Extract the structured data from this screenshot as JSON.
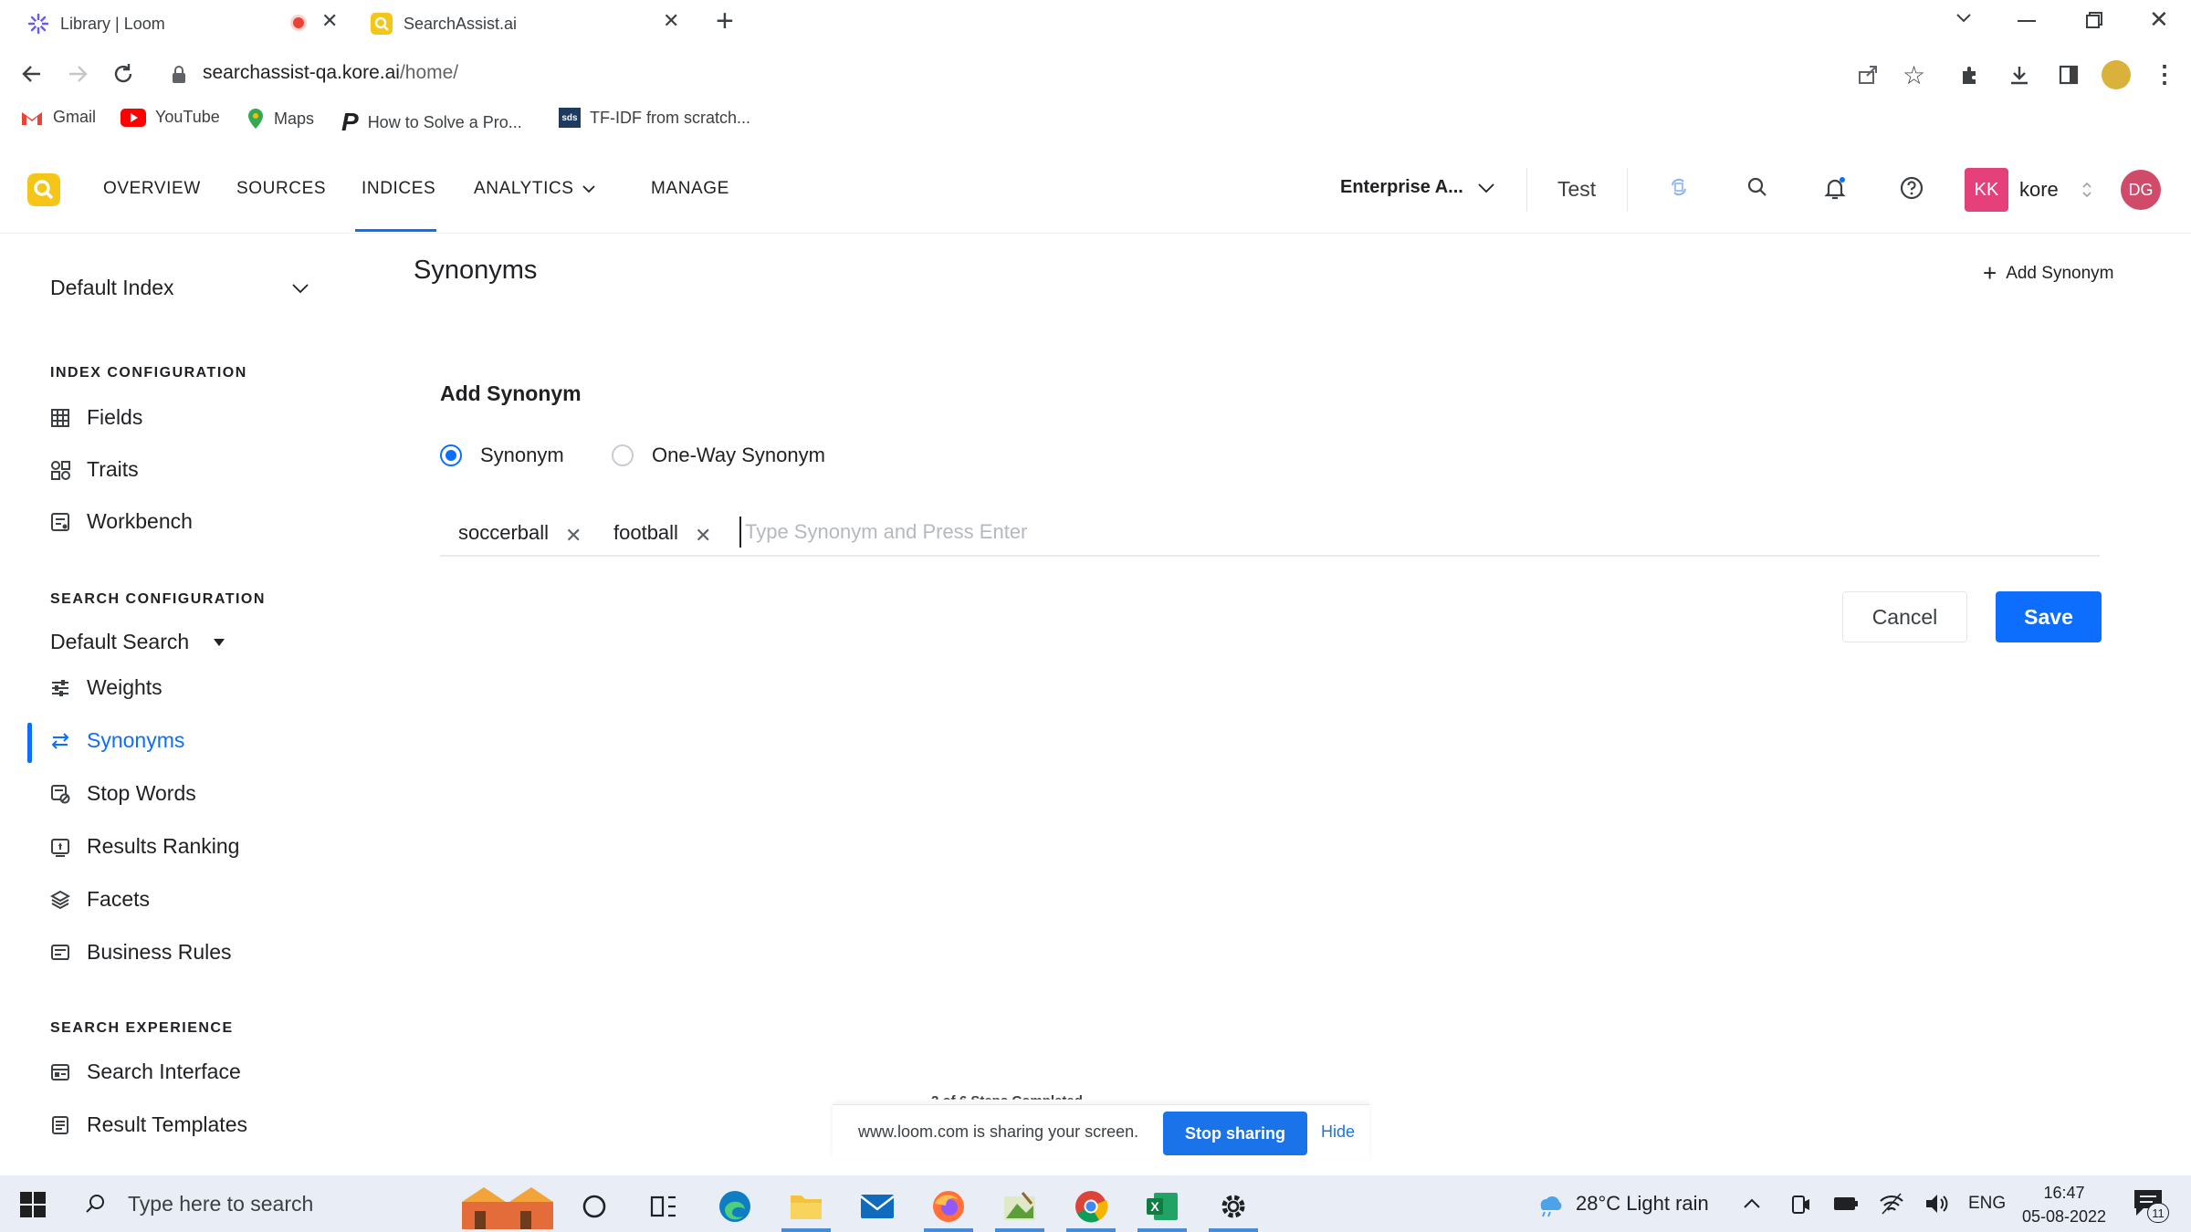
{
  "browser": {
    "tabs": [
      {
        "title": "Library | Loom",
        "icon": "loom-icon",
        "recording": true
      },
      {
        "title": "SearchAssist.ai",
        "icon": "searchassist-icon",
        "active": true
      }
    ],
    "url_host": "searchassist-qa.kore.ai",
    "url_path": "/home/",
    "bookmarks": [
      {
        "label": "Gmail",
        "icon": "gmail-icon"
      },
      {
        "label": "YouTube",
        "icon": "youtube-icon"
      },
      {
        "label": "Maps",
        "icon": "maps-icon"
      },
      {
        "label": "How to Solve a Pro...",
        "icon": "p-logo-icon"
      },
      {
        "label": "TF-IDF from scratch...",
        "icon": "sds-icon"
      }
    ]
  },
  "header": {
    "nav": [
      "OVERVIEW",
      "SOURCES",
      "INDICES",
      "ANALYTICS",
      "MANAGE"
    ],
    "active_nav": "INDICES",
    "workspace": "Enterprise A...",
    "test_label": "Test",
    "account_initials": "KK",
    "account_name": "kore",
    "user_initials": "DG",
    "accent_color": "#0d6efd",
    "logo_color": "#f5c518",
    "account_color": "#e5407a",
    "user_color": "#d04a6a"
  },
  "sidebar": {
    "index_selector": "Default Index",
    "sections": {
      "index_config": "INDEX CONFIGURATION",
      "search_config": "SEARCH CONFIGURATION",
      "search_experience": "SEARCH EXPERIENCE"
    },
    "index_items": [
      "Fields",
      "Traits",
      "Workbench"
    ],
    "search_selector": "Default Search",
    "search_items": [
      "Weights",
      "Synonyms",
      "Stop Words",
      "Results Ranking",
      "Facets",
      "Business Rules"
    ],
    "experience_items": [
      "Search Interface",
      "Result Templates"
    ],
    "active_item": "Synonyms"
  },
  "main": {
    "title": "Synonyms",
    "add_link": "Add Synonym",
    "form_title": "Add Synonym",
    "radio_options": [
      "Synonym",
      "One-Way Synonym"
    ],
    "selected_radio": "Synonym",
    "chips": [
      "soccerball",
      "football"
    ],
    "input_placeholder": "Type Synonym and Press Enter",
    "cancel_label": "Cancel",
    "save_label": "Save"
  },
  "share_bar": {
    "progress_text": "2 of 6 Steps Completed",
    "message": "www.loom.com is sharing your screen.",
    "stop_label": "Stop sharing",
    "hide_label": "Hide"
  },
  "taskbar": {
    "search_placeholder": "Type here to search",
    "weather": "28°C  Light rain",
    "language": "ENG",
    "time": "16:47",
    "date": "05-08-2022",
    "notification_count": "11"
  }
}
